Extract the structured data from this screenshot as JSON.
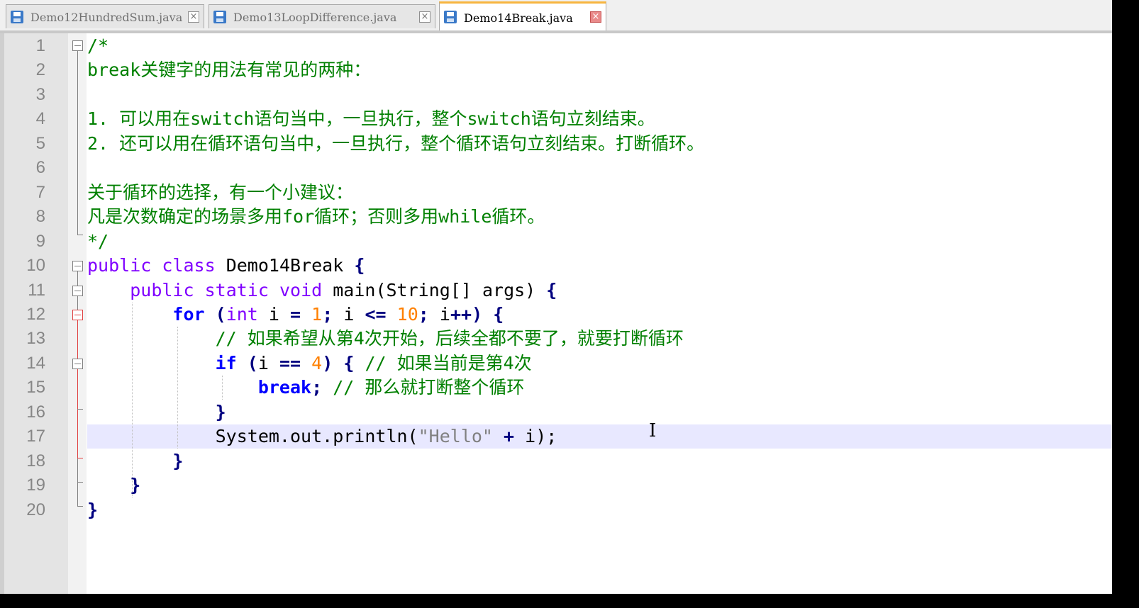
{
  "tabs": [
    {
      "label": "Demo12HundredSum.java",
      "active": false,
      "close": "×"
    },
    {
      "label": "Demo13LoopDifference.java",
      "active": false,
      "close": "×"
    },
    {
      "label": "Demo14Break.java",
      "active": true,
      "close": "×"
    }
  ],
  "editor": {
    "line_numbers": [
      "1",
      "2",
      "3",
      "4",
      "5",
      "6",
      "7",
      "8",
      "9",
      "10",
      "11",
      "12",
      "13",
      "14",
      "15",
      "16",
      "17",
      "18",
      "19",
      "20"
    ],
    "current_line": 17,
    "lines": {
      "l1": "/*",
      "l2": "break关键字的用法有常见的两种：",
      "l3": "",
      "l4": "1. 可以用在switch语句当中，一旦执行，整个switch语句立刻结束。",
      "l5": "2. 还可以用在循环语句当中，一旦执行，整个循环语句立刻结束。打断循环。",
      "l6": "",
      "l7": "关于循环的选择，有一个小建议：",
      "l8": "凡是次数确定的场景多用for循环；否则多用while循环。",
      "l9": "*/",
      "l10": {
        "kw1": "public",
        "kw2": "class",
        "name": "Demo14Break",
        "brace": "{"
      },
      "l11": {
        "kw1": "public",
        "kw2": "static",
        "kw3": "void",
        "name": "main(String[] args)",
        "brace": "{"
      },
      "l12": {
        "kw": "for",
        "open": "(",
        "type": "int",
        "a": "i",
        "eq": "=",
        "n1": "1",
        "semi1": ";",
        "b": "i",
        "le": "<=",
        "n2": "10",
        "semi2": ";",
        "c": "i",
        "inc": "++",
        "close": ")",
        "brace": "{"
      },
      "l13": "// 如果希望从第4次开始，后续全都不要了，就要打断循环",
      "l14": {
        "kw": "if",
        "open": "(",
        "a": "i",
        "eq": "==",
        "n": "4",
        "close": ")",
        "brace": "{",
        "comment": "// 如果当前是第4次"
      },
      "l15": {
        "kw": "break",
        "semi": ";",
        "comment": "// 那么就打断整个循环"
      },
      "l16": "}",
      "l17": {
        "pre": "System.out.println(",
        "str": "\"Hello\"",
        "plus": "+",
        "post": "i);"
      },
      "l18": "}",
      "l19": "}",
      "l20": "}"
    }
  },
  "colors": {
    "comment": "#008000",
    "keyword": "#0000ff",
    "type": "#8000ff",
    "number": "#ff8000",
    "string": "#808080",
    "current_line_bg": "#e8e8ff",
    "active_tab_accent": "#f7b53f"
  },
  "icons": {
    "tab_file": "save-disk-icon",
    "tab_close": "close-icon",
    "fold": "fold-minus-icon",
    "cursor": "text-cursor-icon"
  }
}
